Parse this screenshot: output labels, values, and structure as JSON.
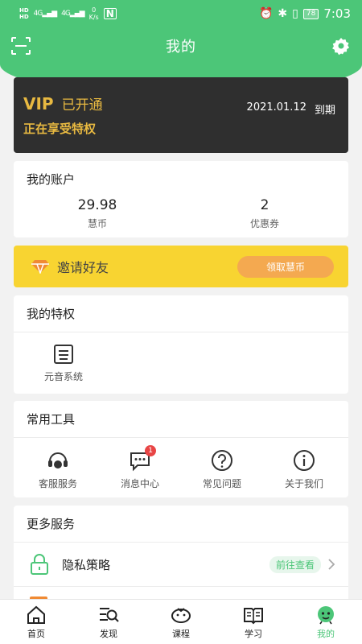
{
  "status_bar": {
    "hd1": "HD",
    "hd2": "HD",
    "net1": "4G",
    "net2": "4G",
    "speed_value": "0",
    "speed_unit": "K/s",
    "nfc": "N",
    "battery": "78",
    "time": "7:03"
  },
  "header": {
    "title": "我的",
    "scan_icon": "scan-icon",
    "settings_icon": "gear-icon"
  },
  "vip": {
    "label": "VIP",
    "status": "已开通",
    "subtitle": "正在享受特权",
    "expire_date": "2021.01.12",
    "expire_label": "到期"
  },
  "account": {
    "title": "我的账户",
    "coins_value": "29.98",
    "coins_label": "慧币",
    "coupons_value": "2",
    "coupons_label": "优惠券"
  },
  "invite": {
    "label": "邀请好友",
    "button": "领取慧币",
    "icon": "diamond-icon"
  },
  "privilege": {
    "title": "我的特权",
    "items": [
      {
        "label": "元音系统",
        "icon": "keyboard-icon"
      }
    ]
  },
  "tools": {
    "title": "常用工具",
    "items": [
      {
        "label": "客服服务",
        "icon": "headset-icon"
      },
      {
        "label": "消息中心",
        "icon": "message-icon",
        "badge": "1"
      },
      {
        "label": "常见问题",
        "icon": "question-icon"
      },
      {
        "label": "关于我们",
        "icon": "info-icon"
      }
    ]
  },
  "more": {
    "title": "更多服务",
    "items": [
      {
        "label": "隐私策略",
        "tag": "前往查看",
        "icon": "lock-icon"
      }
    ]
  },
  "nav": {
    "items": [
      {
        "label": "首页",
        "icon": "home-icon"
      },
      {
        "label": "发现",
        "icon": "discover-icon"
      },
      {
        "label": "课程",
        "icon": "course-icon"
      },
      {
        "label": "学习",
        "icon": "book-icon"
      },
      {
        "label": "我的",
        "icon": "profile-icon"
      }
    ],
    "active_index": 4
  },
  "colors": {
    "brand_green": "#4cc678",
    "vip_gold": "#e8b941",
    "vip_bg": "#2f2f2f",
    "invite_yellow": "#f8d431",
    "claim_orange": "#f4a950",
    "badge_red": "#e84545"
  }
}
